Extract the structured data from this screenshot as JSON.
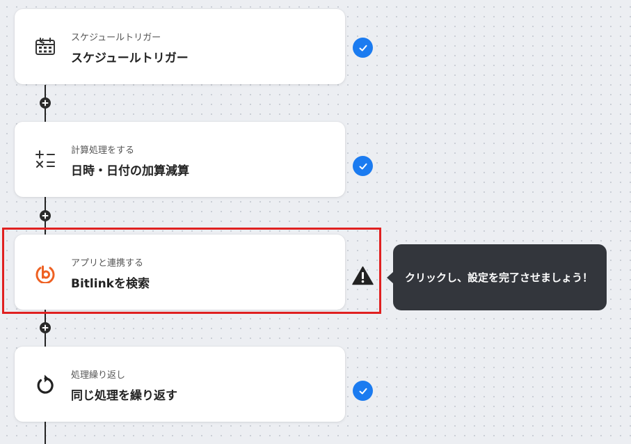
{
  "flow": {
    "steps": [
      {
        "icon": "calendar-bolt-icon",
        "subtitle": "スケジュールトリガー",
        "title": "スケジュールトリガー",
        "status": "complete"
      },
      {
        "icon": "arithmetic-operators-icon",
        "subtitle": "計算処理をする",
        "title": "日時・日付の加算減算",
        "status": "complete"
      },
      {
        "icon": "bitly-logo-icon",
        "subtitle": "アプリと連携する",
        "title": "Bitlinkを検索",
        "status": "warning"
      },
      {
        "icon": "loop-arrow-icon",
        "subtitle": "処理繰り返し",
        "title": "同じ処理を繰り返す",
        "status": "complete"
      }
    ]
  },
  "tooltip": {
    "text": "クリックし、設定を完了させましょう！"
  },
  "colors": {
    "check": "#1b7bf0",
    "highlight": "#e02020",
    "bitly_orange": "#ee6123",
    "tooltip_bg": "#33363c"
  }
}
